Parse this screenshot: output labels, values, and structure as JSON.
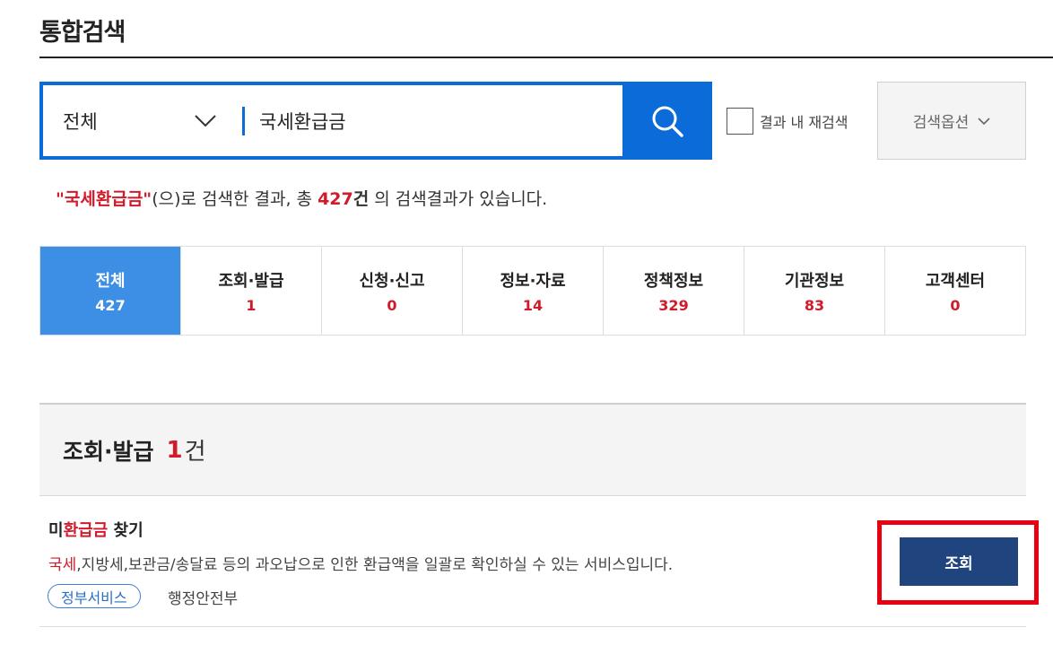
{
  "page": {
    "title": "통합검색"
  },
  "search": {
    "category": "전체",
    "query": "국세환급금",
    "rescan_label": "결과 내 재검색",
    "options_label": "검색옵션"
  },
  "summary": {
    "quoted_keyword": "\"국세환급금\"",
    "text1": "(으)로 검색한 결과, 총 ",
    "total": "427",
    "unit": "건",
    "text2": " 의 검색결과가 있습니다."
  },
  "tabs": [
    {
      "label": "전체",
      "count": "427",
      "active": true
    },
    {
      "label": "조회·발급",
      "count": "1"
    },
    {
      "label": "신청·신고",
      "count": "0"
    },
    {
      "label": "정보·자료",
      "count": "14"
    },
    {
      "label": "정책정보",
      "count": "329"
    },
    {
      "label": "기관정보",
      "count": "83"
    },
    {
      "label": "고객센터",
      "count": "0"
    }
  ],
  "section": {
    "title": "조회·발급",
    "count": "1",
    "unit": "건"
  },
  "result": {
    "title_pre": "미",
    "title_hl": "환급금",
    "title_post": " 찾기",
    "desc_hl": "국세",
    "desc_rest": ",지방세,보관금/송달료 등의 과오납으로 인한 환급액을 일괄로 확인하실 수 있는 서비스입니다.",
    "tag": "정부서비스",
    "org": "행정안전부",
    "button_label": "조회"
  },
  "colors": {
    "primary": "#0b6cd9",
    "active_tab": "#3d8fe6",
    "accent_red": "#d11a2a",
    "button_navy": "#1f447e",
    "highlight": "#e60012"
  }
}
